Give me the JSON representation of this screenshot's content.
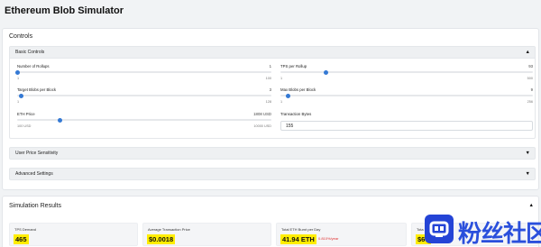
{
  "app": {
    "title": "Ethereum Blob Simulator"
  },
  "controls": {
    "title": "Controls",
    "basic": {
      "label": "Basic Controls",
      "num_rollups": {
        "label": "Number of Rollups",
        "value": "1",
        "min": "1",
        "max": "100",
        "fraction": 0.0
      },
      "tps_per_rollup": {
        "label": "TPS per Rollup",
        "value": "93",
        "min": "1",
        "max": "500",
        "fraction": 0.18
      },
      "target_blobs": {
        "label": "Target Blobs per Block",
        "value": "3",
        "min": "1",
        "max": "128",
        "fraction": 0.016
      },
      "max_blobs": {
        "label": "Max Blobs per Block",
        "value": "9",
        "min": "1",
        "max": "256",
        "fraction": 0.03
      },
      "eth_price": {
        "label": "ETH Price",
        "value": "1808 USD",
        "min": "100 USD",
        "max": "10000 USD",
        "fraction": 0.17
      },
      "tx_bytes": {
        "label": "Transaction Bytes",
        "value": "155"
      }
    },
    "user_price_sensitivity": {
      "label": "User Price Sensitivity"
    },
    "advanced_settings": {
      "label": "Advanced Settings"
    }
  },
  "results": {
    "title": "Simulation Results",
    "tps_demand": {
      "label": "TPS Demand",
      "value": "465"
    },
    "avg_tx_price": {
      "label": "Average Transaction Price",
      "value": "$0.0018"
    },
    "eth_burnt": {
      "label": "Total ETH Burnt per Day",
      "value": "41.94 ETH",
      "sub": "0.810%/year"
    },
    "fourth": {
      "label": "Tota",
      "value": "$67"
    }
  },
  "icons": {
    "collapse": "caret-up-icon",
    "expand": "caret-down-icon"
  },
  "colors": {
    "accent": "#3479d4",
    "highlight": "#ffed00",
    "negative": "#e03131"
  },
  "watermark": {
    "text": "粉丝社区"
  }
}
